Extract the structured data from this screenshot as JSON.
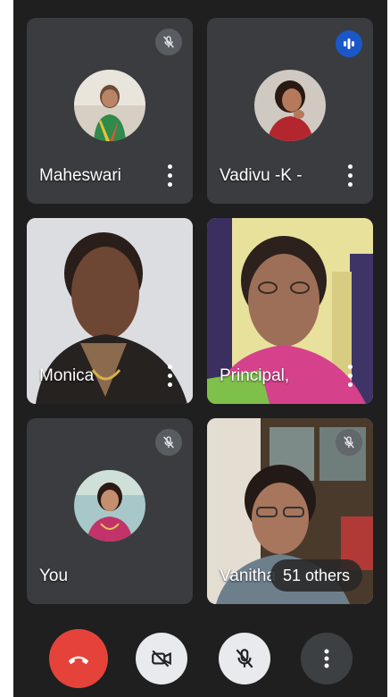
{
  "participants": [
    {
      "name": "Maheswari",
      "status": "muted"
    },
    {
      "name": "Vadivu -K -",
      "status": "speaking"
    },
    {
      "name": "Monica",
      "status": "video"
    },
    {
      "name": "Principal,",
      "status": "video"
    },
    {
      "name": "You",
      "status": "muted"
    },
    {
      "name": "Vanitha",
      "status": "muted"
    }
  ],
  "others_label": "51 others",
  "colors": {
    "background": "#1f1f1f",
    "tile": "#3c4043",
    "end_call": "#e5433a",
    "speaking": "#1a57c9",
    "control_light": "#e8eaed"
  },
  "controls": {
    "end_call_icon": "call-end-icon",
    "camera_icon": "camera-off-icon",
    "mic_icon": "mic-off-icon",
    "more_icon": "more-vertical-icon"
  }
}
